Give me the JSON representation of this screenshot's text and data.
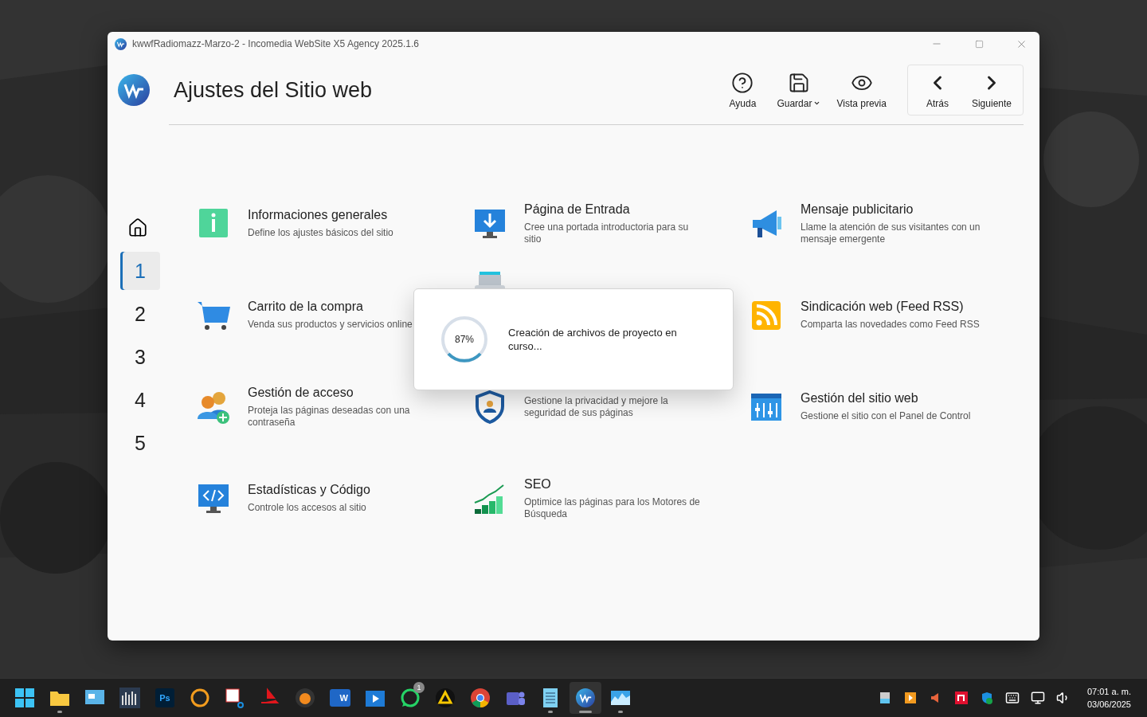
{
  "window": {
    "title": "kwwfRadiomazz-Marzo-2 - Incomedia WebSite X5 Agency 2025.1.6"
  },
  "header": {
    "title": "Ajustes del Sitio web",
    "tools": [
      {
        "kind": "help",
        "label": "Ayuda",
        "dropdown": false
      },
      {
        "kind": "save",
        "label": "Guardar",
        "dropdown": true
      },
      {
        "kind": "eye",
        "label": "Vista previa",
        "dropdown": false
      }
    ],
    "nav": [
      {
        "kind": "back",
        "label": "Atrás"
      },
      {
        "kind": "next",
        "label": "Siguiente"
      }
    ]
  },
  "steps": [
    {
      "label": "1",
      "selected": true
    },
    {
      "label": "2",
      "selected": false
    },
    {
      "label": "3",
      "selected": false
    },
    {
      "label": "4",
      "selected": false
    },
    {
      "label": "5",
      "selected": false
    }
  ],
  "categories": [
    {
      "kind": "info",
      "title": "Informaciones generales",
      "description": "Define los ajustes básicos del sitio"
    },
    {
      "kind": "monitor",
      "title": "Página de Entrada",
      "description": "Cree una portada introductoria para su sitio"
    },
    {
      "kind": "megaphone",
      "title": "Mensaje publicitario",
      "description": "Llame la atención de sus visitantes con un mensaje emergente"
    },
    {
      "kind": "cart",
      "title": "Carrito de la compra",
      "description": "Venda sus productos y servicios online"
    },
    {
      "kind": "typewriter"
    },
    {
      "kind": "rss",
      "title": "Sindicación web (Feed RSS)",
      "description": "Comparta las novedades como Feed RSS"
    },
    {
      "kind": "users",
      "title": "Gestión de acceso",
      "description": "Proteja las páginas deseadas con una contraseña"
    },
    {
      "kind": "shield",
      "description": "Gestione la privacidad y mejore la seguridad de sus páginas"
    },
    {
      "kind": "panel",
      "title": "Gestión del sitio web",
      "description": "Gestione el sitio con el Panel de Control"
    },
    {
      "kind": "code",
      "title": "Estadísticas y Código",
      "description": "Controle los accesos al sitio"
    },
    {
      "kind": "seo",
      "title": "SEO",
      "description": "Optimice las páginas para los Motores de Búsqueda"
    }
  ],
  "progress_dialog": {
    "percent": "87%",
    "message": "Creación de archivos de proyecto en curso..."
  },
  "taskbar": {
    "apps": [
      {
        "kind": "start",
        "running": false,
        "selected": false
      },
      {
        "kind": "folder",
        "running": true,
        "selected": false
      },
      {
        "kind": "presentation",
        "running": false,
        "selected": false
      },
      {
        "kind": "barcode",
        "running": false,
        "selected": false
      },
      {
        "kind": "photoshop",
        "label": "Ps",
        "running": false,
        "selected": false
      },
      {
        "kind": "ring",
        "running": false,
        "selected": false
      },
      {
        "kind": "scissors",
        "running": false,
        "selected": false
      },
      {
        "kind": "arrow",
        "running": false,
        "selected": false
      },
      {
        "kind": "fruit",
        "running": false,
        "selected": false
      },
      {
        "kind": "word",
        "label": "W",
        "running": false,
        "selected": false
      },
      {
        "kind": "video",
        "running": false,
        "selected": false
      },
      {
        "kind": "whatsapp",
        "badge": "1",
        "running": false,
        "selected": false
      },
      {
        "kind": "triangle",
        "running": false,
        "selected": false
      },
      {
        "kind": "chrome",
        "running": false,
        "selected": false
      },
      {
        "kind": "teams",
        "running": false,
        "selected": false
      },
      {
        "kind": "notepad",
        "running": true,
        "selected": false
      },
      {
        "kind": "ws5",
        "running": true,
        "selected": true
      },
      {
        "kind": "chart",
        "running": true,
        "selected": false
      }
    ],
    "time": "07:01 a. m.",
    "date": "03/06/2025"
  }
}
